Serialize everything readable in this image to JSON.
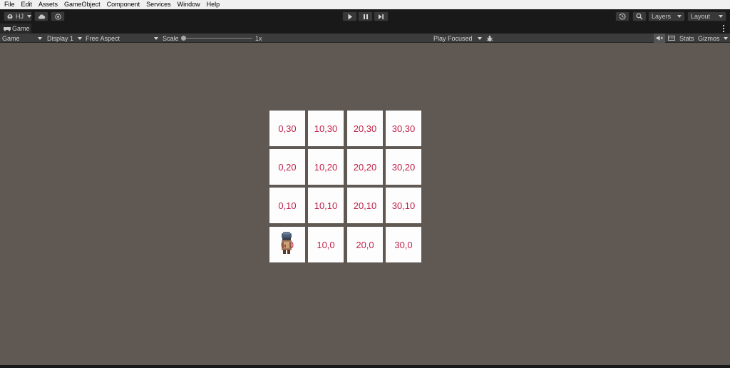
{
  "menu": [
    "File",
    "Edit",
    "Assets",
    "GameObject",
    "Component",
    "Services",
    "Window",
    "Help"
  ],
  "toolbar": {
    "account_label": "HJ",
    "layers_label": "Layers",
    "layout_label": "Layout",
    "icons": [
      "account-icon",
      "cloud-icon",
      "collab-icon",
      "play-icon",
      "pause-icon",
      "step-icon",
      "history-icon",
      "search-icon"
    ]
  },
  "game_tab": {
    "title": "Game"
  },
  "game_toolbar": {
    "mode": "Game",
    "display": "Display 1",
    "aspect": "Free Aspect",
    "scale_label": "Scale",
    "scale_value": "1x",
    "play_mode": "Play Focused",
    "stats": "Stats",
    "gizmos": "Gizmos"
  },
  "grid": {
    "rows": [
      [
        "0,30",
        "10,30",
        "20,30",
        "30,30"
      ],
      [
        "0,20",
        "10,20",
        "20,20",
        "30,20"
      ],
      [
        "0,10",
        "10,10",
        "20,10",
        "30,10"
      ],
      [
        "0,0",
        "10,0",
        "20,0",
        "30,0"
      ]
    ]
  },
  "colors": {
    "tile_text": "#c0224a",
    "viewport_bg": "#5f5853",
    "toolbar_bg": "#191919"
  }
}
